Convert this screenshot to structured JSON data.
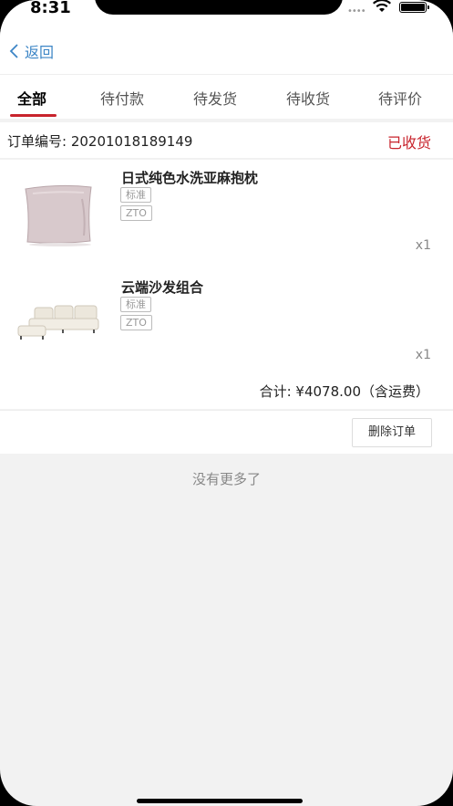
{
  "status_bar": {
    "time": "8:31",
    "signal": "••••"
  },
  "nav": {
    "back_label": "返回"
  },
  "tabs": [
    {
      "label": "全部",
      "active": true
    },
    {
      "label": "待付款",
      "active": false
    },
    {
      "label": "待发货",
      "active": false
    },
    {
      "label": "待收货",
      "active": false
    },
    {
      "label": "待评价",
      "active": false
    }
  ],
  "order": {
    "number_text": "订单编号: 20201018189149",
    "status": "已收货",
    "items": [
      {
        "name": "日式纯色水洗亚麻抱枕",
        "tag_spec": "标准",
        "tag_ship": "ZTO",
        "qty": "x1",
        "image": "pillow-image"
      },
      {
        "name": "云端沙发组合",
        "tag_spec": "标准",
        "tag_ship": "ZTO",
        "qty": "x1",
        "image": "sofa-image"
      }
    ],
    "total_text": "合计: ¥4078.00（含运费）",
    "delete_label": "删除订单"
  },
  "footer": {
    "no_more": "没有更多了"
  },
  "colors": {
    "accent_red": "#c8232c",
    "link_blue": "#3d86c6"
  }
}
